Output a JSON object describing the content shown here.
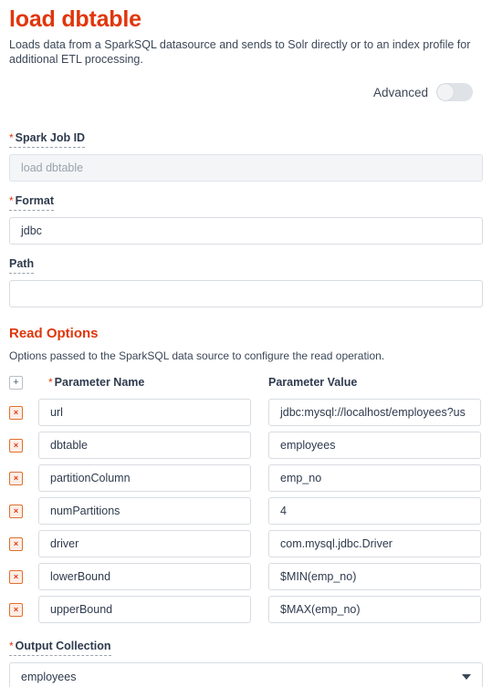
{
  "header": {
    "title": "load dbtable",
    "description": "Loads data from a SparkSQL datasource and sends to Solr directly or to an index profile for additional ETL processing.",
    "advanced_label": "Advanced",
    "advanced_on": false
  },
  "fields": {
    "spark_job_id": {
      "label": "Spark Job ID",
      "required_marker": "*",
      "value": "load dbtable",
      "disabled": true
    },
    "format": {
      "label": "Format",
      "required_marker": "*",
      "value": "jdbc",
      "disabled": false
    },
    "path": {
      "label": "Path",
      "required_marker": "",
      "value": "",
      "disabled": false
    }
  },
  "read_options": {
    "section_title": "Read Options",
    "section_description": "Options passed to the SparkSQL data source to configure the read operation.",
    "add_button": "+",
    "remove_button": "×",
    "columns": {
      "name": "Parameter Name",
      "name_required_marker": "*",
      "value": "Parameter Value"
    },
    "rows": [
      {
        "name": "url",
        "value": "jdbc:mysql://localhost/employees?us"
      },
      {
        "name": "dbtable",
        "value": "employees"
      },
      {
        "name": "partitionColumn",
        "value": "emp_no"
      },
      {
        "name": "numPartitions",
        "value": "4"
      },
      {
        "name": "driver",
        "value": "com.mysql.jdbc.Driver"
      },
      {
        "name": "lowerBound",
        "value": "$MIN(emp_no)"
      },
      {
        "name": "upperBound",
        "value": "$MAX(emp_no)"
      }
    ]
  },
  "output_collection": {
    "label": "Output Collection",
    "required_marker": "*",
    "selected": "employees"
  },
  "colors": {
    "accent": "#e0360c",
    "text": "#2e3a4d",
    "border": "#d8dce1",
    "disabled_bg": "#f3f5f7"
  }
}
